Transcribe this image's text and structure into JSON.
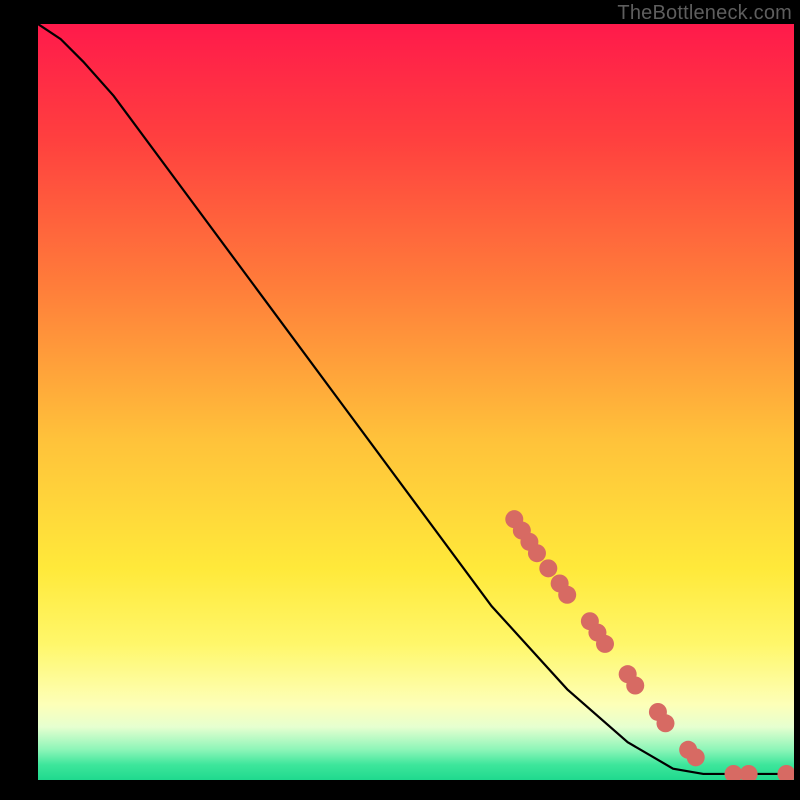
{
  "watermark": "TheBottleneck.com",
  "chart_data": {
    "type": "line",
    "title": "",
    "xlabel": "",
    "ylabel": "",
    "xlim": [
      0,
      100
    ],
    "ylim": [
      0,
      100
    ],
    "gradient_stops": [
      {
        "offset": 0,
        "color": "#ff1a4b"
      },
      {
        "offset": 15,
        "color": "#ff3f3f"
      },
      {
        "offset": 35,
        "color": "#ff7e3a"
      },
      {
        "offset": 55,
        "color": "#ffc23a"
      },
      {
        "offset": 72,
        "color": "#ffe93a"
      },
      {
        "offset": 82,
        "color": "#fff76a"
      },
      {
        "offset": 90,
        "color": "#fdffb8"
      },
      {
        "offset": 93,
        "color": "#e6ffd0"
      },
      {
        "offset": 96,
        "color": "#8cf5b8"
      },
      {
        "offset": 98,
        "color": "#3de69b"
      },
      {
        "offset": 100,
        "color": "#1fd98e"
      }
    ],
    "curve": [
      {
        "x": 0,
        "y": 100
      },
      {
        "x": 3,
        "y": 98
      },
      {
        "x": 6,
        "y": 95
      },
      {
        "x": 10,
        "y": 90.5
      },
      {
        "x": 20,
        "y": 77
      },
      {
        "x": 30,
        "y": 63.5
      },
      {
        "x": 40,
        "y": 50
      },
      {
        "x": 50,
        "y": 36.5
      },
      {
        "x": 60,
        "y": 23
      },
      {
        "x": 70,
        "y": 12
      },
      {
        "x": 78,
        "y": 5
      },
      {
        "x": 84,
        "y": 1.5
      },
      {
        "x": 88,
        "y": 0.8
      },
      {
        "x": 100,
        "y": 0.8
      }
    ],
    "points_color": "#d76a63",
    "points_radius": 9,
    "points": [
      {
        "x": 63,
        "y": 34.5
      },
      {
        "x": 64,
        "y": 33
      },
      {
        "x": 65,
        "y": 31.5
      },
      {
        "x": 66,
        "y": 30
      },
      {
        "x": 67.5,
        "y": 28
      },
      {
        "x": 69,
        "y": 26
      },
      {
        "x": 70,
        "y": 24.5
      },
      {
        "x": 73,
        "y": 21
      },
      {
        "x": 74,
        "y": 19.5
      },
      {
        "x": 75,
        "y": 18
      },
      {
        "x": 78,
        "y": 14
      },
      {
        "x": 79,
        "y": 12.5
      },
      {
        "x": 82,
        "y": 9
      },
      {
        "x": 83,
        "y": 7.5
      },
      {
        "x": 86,
        "y": 4
      },
      {
        "x": 87,
        "y": 3
      },
      {
        "x": 92,
        "y": 0.8
      },
      {
        "x": 94,
        "y": 0.8
      },
      {
        "x": 99,
        "y": 0.8
      }
    ]
  }
}
